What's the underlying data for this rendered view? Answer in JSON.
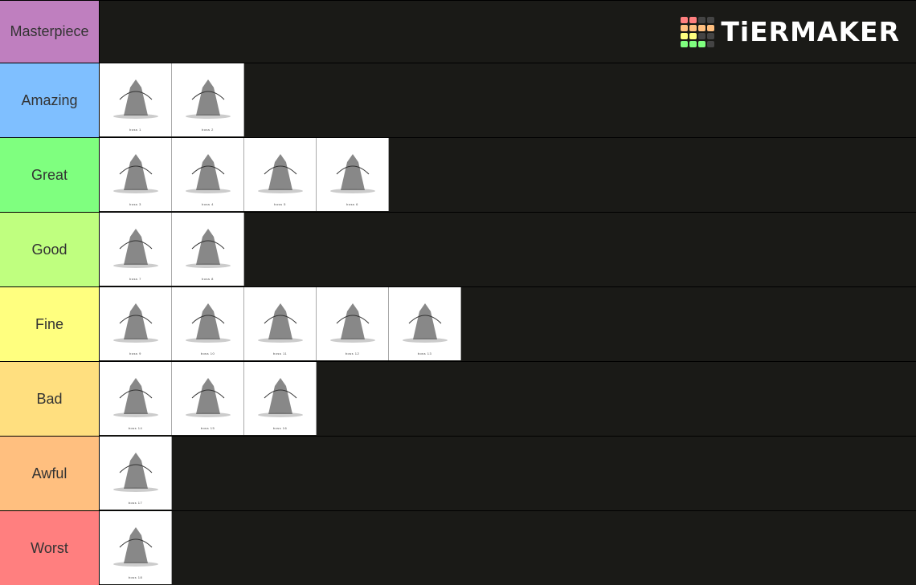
{
  "app": {
    "brand": "TiERMAKER"
  },
  "logo_grid_colors": [
    "#ff7f7f",
    "#ff7f7f",
    "#444444",
    "#444444",
    "#ffbf7f",
    "#ffbf7f",
    "#ffbf7f",
    "#ffbf7f",
    "#ffff7f",
    "#ffff7f",
    "#444444",
    "#444444",
    "#7fff7f",
    "#7fff7f",
    "#7fff7f",
    "#444444"
  ],
  "tiers": [
    {
      "label": "Masterpiece",
      "color": "#bf7fbf",
      "items": []
    },
    {
      "label": "Amazing",
      "color": "#7fbfff",
      "items": [
        {
          "caption": "boss 1"
        },
        {
          "caption": "boss 2"
        }
      ]
    },
    {
      "label": "Great",
      "color": "#7fff7f",
      "items": [
        {
          "caption": "boss 3"
        },
        {
          "caption": "boss 4"
        },
        {
          "caption": "boss 5"
        },
        {
          "caption": "boss 6"
        }
      ]
    },
    {
      "label": "Good",
      "color": "#bfff7f",
      "items": [
        {
          "caption": "boss 7"
        },
        {
          "caption": "boss 8"
        }
      ]
    },
    {
      "label": "Fine",
      "color": "#ffff7f",
      "items": [
        {
          "caption": "boss 9"
        },
        {
          "caption": "boss 10"
        },
        {
          "caption": "boss 11"
        },
        {
          "caption": "boss 12"
        },
        {
          "caption": "boss 13"
        }
      ]
    },
    {
      "label": "Bad",
      "color": "#ffdf7f",
      "items": [
        {
          "caption": "boss 14"
        },
        {
          "caption": "boss 15"
        },
        {
          "caption": "boss 16"
        }
      ]
    },
    {
      "label": "Awful",
      "color": "#ffbf7f",
      "items": [
        {
          "caption": "boss 17"
        }
      ]
    },
    {
      "label": "Worst",
      "color": "#ff7f7f",
      "items": [
        {
          "caption": "boss 18"
        }
      ]
    }
  ]
}
